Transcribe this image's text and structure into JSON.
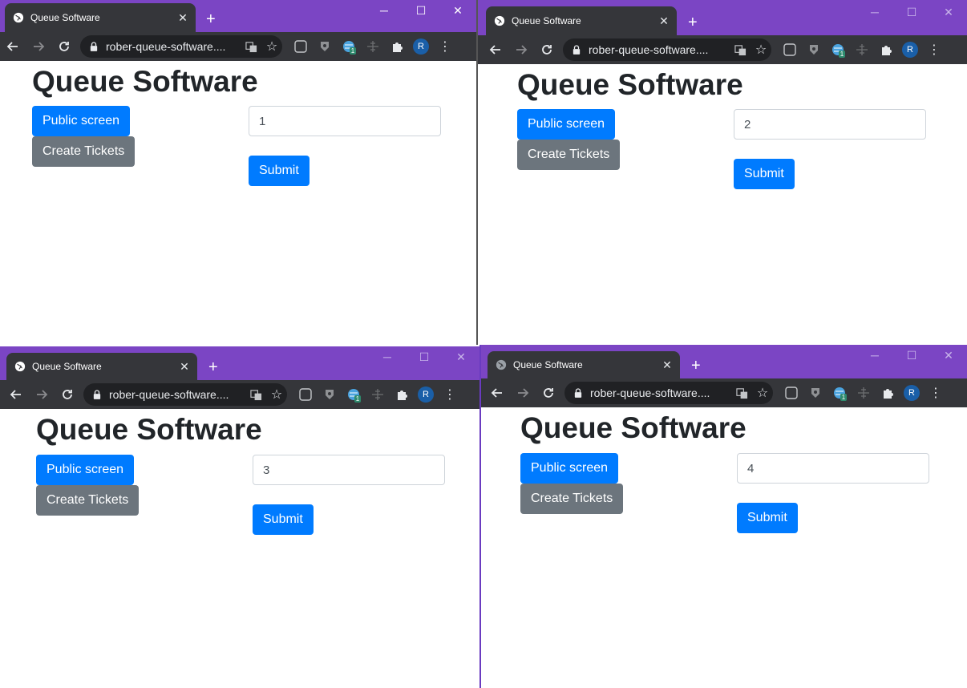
{
  "windows": [
    {
      "tab_title": "Queue Software",
      "url": "rober-queue-software....",
      "heading": "Queue Software",
      "public_screen_label": "Public screen",
      "create_tickets_label": "Create Tickets",
      "input_value": "1",
      "submit_label": "Submit",
      "profile_initial": "R",
      "extension_badge": "1"
    },
    {
      "tab_title": "Queue Software",
      "url": "rober-queue-software....",
      "heading": "Queue Software",
      "public_screen_label": "Public screen",
      "create_tickets_label": "Create Tickets",
      "input_value": "2",
      "submit_label": "Submit",
      "profile_initial": "R",
      "extension_badge": "1"
    },
    {
      "tab_title": "Queue Software",
      "url": "rober-queue-software....",
      "heading": "Queue Software",
      "public_screen_label": "Public screen",
      "create_tickets_label": "Create Tickets",
      "input_value": "3",
      "submit_label": "Submit",
      "profile_initial": "R",
      "extension_badge": "1"
    },
    {
      "tab_title": "Queue Software",
      "url": "rober-queue-software....",
      "heading": "Queue Software",
      "public_screen_label": "Public screen",
      "create_tickets_label": "Create Tickets",
      "input_value": "4",
      "submit_label": "Submit",
      "profile_initial": "R",
      "extension_badge": "1"
    }
  ],
  "icons": {
    "tab_favicon": "globe-icon",
    "tab_close": "close-icon",
    "new_tab": "plus-icon",
    "back": "arrow-left-icon",
    "forward": "arrow-right-icon",
    "reload": "reload-icon",
    "lock": "lock-icon",
    "translate": "translate-icon",
    "bookmark": "star-icon",
    "extensions": [
      "dark-mode-icon",
      "shield-icon",
      "globe-extension-icon",
      "ruler-icon",
      "puzzle-icon"
    ],
    "menu": "kebab-menu-icon",
    "window_controls": [
      "minimize-icon",
      "maximize-icon",
      "close-window-icon"
    ]
  },
  "colors": {
    "titlebar": "#7b45c4",
    "toolbar": "#35363a",
    "primary_button": "#007bff",
    "secondary_button": "#6c757d",
    "heading_text": "#212529"
  }
}
